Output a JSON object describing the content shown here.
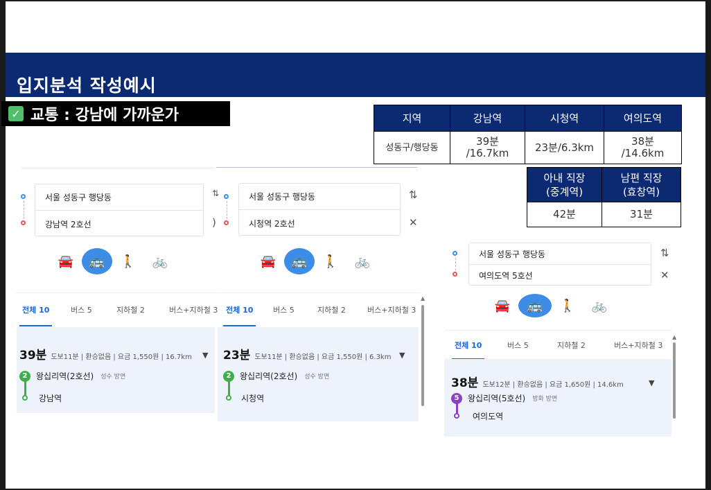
{
  "slide": {
    "title": "입지분석 작성예시",
    "section": {
      "check": "✓",
      "label": "교통 : 강남에 가까운가"
    }
  },
  "table1": {
    "headers": [
      "지역",
      "강남역",
      "시청역",
      "여의도역"
    ],
    "row": [
      "성동구/행당동",
      "39분\n/16.7km",
      "23분/6.3km",
      "38분\n/14.6km"
    ]
  },
  "table2": {
    "headers": [
      "아내 직장\n(중계역)",
      "남편 직장\n(효창역)"
    ],
    "row": [
      "42분",
      "31분"
    ]
  },
  "colors": {
    "brand_navy": "#0b2a72",
    "accent_blue": "#3d8ce6",
    "line2_green": "#3fae49",
    "line5_purple": "#8b3fc6"
  },
  "icons": {
    "swap": "swap-vertical-icon",
    "close": "close-icon",
    "modes": [
      "car-icon",
      "bus-icon",
      "walk-icon",
      "bike-icon"
    ]
  },
  "panels": [
    {
      "origin": "서울 성동구 행당동",
      "destination": "강남역 2호선",
      "swap": "⇅",
      "close": ")",
      "tabs": [
        "전체 10",
        "버스 5",
        "지하철 2",
        "버스+지하철 3"
      ],
      "result": {
        "time": "39분",
        "meta": "도보11분 | 환승없음 | 요금 1,550원 | 16.7km",
        "line_badge": "2",
        "board_station": "왕십리역(2호선)",
        "direction": "성수 방면",
        "arrive_station": "강남역"
      }
    },
    {
      "origin": "서울 성동구 행당동",
      "destination": "시청역 2호선",
      "swap": "⇅",
      "close": "✕",
      "tabs": [
        "전체 10",
        "버스 5",
        "지하철 2",
        "버스+지하철 3"
      ],
      "result": {
        "time": "23분",
        "meta": "도보11분 | 환승없음 | 요금 1,550원 | 6.3km",
        "line_badge": "2",
        "board_station": "왕십리역(2호선)",
        "direction": "성수 방면",
        "arrive_station": "시청역"
      }
    },
    {
      "origin": "서울 성동구 행당동",
      "destination": "여의도역 5호선",
      "swap": "⇅",
      "close": "✕",
      "tabs": [
        "전체 10",
        "버스 5",
        "지하철 2",
        "버스+지하철 3"
      ],
      "result": {
        "time": "38분",
        "meta": "도보12분 | 환승없음 | 요금 1,650원 | 14.6km",
        "line_badge": "5",
        "board_station": "왕십리역(5호선)",
        "direction": "방화 방면",
        "arrive_station": "여의도역"
      }
    }
  ]
}
